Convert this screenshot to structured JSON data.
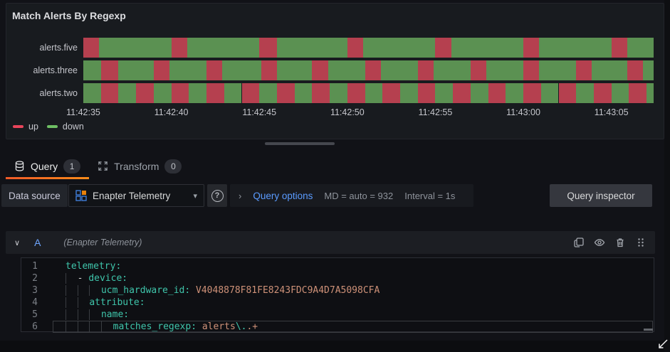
{
  "panel": {
    "title": "Match Alerts By Regexp"
  },
  "chart_data": {
    "type": "state-timeline",
    "title": "Match Alerts By Regexp",
    "time_start": "11:42:35",
    "time_span_seconds": 32.4,
    "ticks": [
      {
        "t": 0,
        "label": "11:42:35"
      },
      {
        "t": 5,
        "label": "11:42:40"
      },
      {
        "t": 10,
        "label": "11:42:45"
      },
      {
        "t": 15,
        "label": "11:42:50"
      },
      {
        "t": 20,
        "label": "11:42:55"
      },
      {
        "t": 25,
        "label": "11:43:00"
      },
      {
        "t": 30,
        "label": "11:43:05"
      }
    ],
    "legend_position": "bottom-left",
    "legend": [
      {
        "label": "up",
        "color": "#e8455a"
      },
      {
        "label": "down",
        "color": "#6ebf64"
      }
    ],
    "state_colors": {
      "up": "#b5404f",
      "down": "#5b9152"
    },
    "series": [
      {
        "name": "alerts.five",
        "segments": [
          [
            "up",
            0,
            0.9
          ],
          [
            "down",
            0.9,
            5
          ],
          [
            "up",
            5,
            5.9
          ],
          [
            "down",
            5.9,
            10
          ],
          [
            "up",
            10,
            11
          ],
          [
            "down",
            11,
            15
          ],
          [
            "up",
            15,
            15.9
          ],
          [
            "down",
            15.9,
            20
          ],
          [
            "up",
            20,
            20.9
          ],
          [
            "down",
            20.9,
            25
          ],
          [
            "up",
            25,
            25.9
          ],
          [
            "down",
            25.9,
            30
          ],
          [
            "up",
            30,
            30.9
          ],
          [
            "down",
            30.9,
            32.4
          ]
        ]
      },
      {
        "name": "alerts.three",
        "segments": [
          [
            "down",
            0,
            1
          ],
          [
            "up",
            1,
            2
          ],
          [
            "down",
            2,
            4
          ],
          [
            "up",
            4,
            4.9
          ],
          [
            "down",
            4.9,
            7
          ],
          [
            "up",
            7,
            7.9
          ],
          [
            "down",
            7.9,
            10.1
          ],
          [
            "up",
            10.1,
            11
          ],
          [
            "down",
            11,
            13
          ],
          [
            "up",
            13,
            13.9
          ],
          [
            "down",
            13.9,
            16
          ],
          [
            "up",
            16,
            16.9
          ],
          [
            "down",
            16.9,
            19
          ],
          [
            "up",
            19,
            19.9
          ],
          [
            "down",
            19.9,
            22
          ],
          [
            "up",
            22,
            22.9
          ],
          [
            "down",
            22.9,
            25
          ],
          [
            "up",
            25,
            25.9
          ],
          [
            "down",
            25.9,
            28
          ],
          [
            "up",
            28,
            28.9
          ],
          [
            "down",
            28.9,
            30.9
          ],
          [
            "up",
            30.9,
            31.8
          ],
          [
            "down",
            31.8,
            32.4
          ]
        ]
      },
      {
        "name": "alerts.two",
        "segments": [
          [
            "down",
            0,
            1
          ],
          [
            "up",
            1,
            2
          ],
          [
            "down",
            2,
            3
          ],
          [
            "up",
            3,
            4
          ],
          [
            "down",
            4,
            5
          ],
          [
            "up",
            5,
            6
          ],
          [
            "down",
            6,
            7
          ],
          [
            "up",
            7,
            8
          ],
          [
            "down",
            8,
            9
          ],
          [
            "up",
            9,
            10
          ],
          [
            "down",
            10,
            11
          ],
          [
            "up",
            11,
            12
          ],
          [
            "down",
            12,
            13
          ],
          [
            "up",
            13,
            14
          ],
          [
            "down",
            14,
            15
          ],
          [
            "up",
            15,
            16
          ],
          [
            "down",
            16,
            17
          ],
          [
            "up",
            17,
            18
          ],
          [
            "down",
            18,
            19
          ],
          [
            "up",
            19,
            20
          ],
          [
            "down",
            20,
            21
          ],
          [
            "up",
            21,
            22
          ],
          [
            "down",
            22,
            23
          ],
          [
            "up",
            23,
            24
          ],
          [
            "down",
            24,
            25
          ],
          [
            "up",
            25,
            26
          ],
          [
            "down",
            26,
            27
          ],
          [
            "up",
            27,
            28
          ],
          [
            "down",
            28,
            29
          ],
          [
            "up",
            29,
            30
          ],
          [
            "down",
            30,
            31
          ],
          [
            "up",
            31,
            32
          ],
          [
            "down",
            32,
            32.4
          ]
        ]
      }
    ]
  },
  "tabs": {
    "query": {
      "label": "Query",
      "count": "1"
    },
    "transform": {
      "label": "Transform",
      "count": "0"
    }
  },
  "toolbar": {
    "datasource_label": "Data source",
    "datasource_value": "Enapter Telemetry",
    "help_glyph": "?",
    "options_chevron": "›",
    "query_options_label": "Query options",
    "max_data_points": "MD = auto = 932",
    "interval": "Interval = 1s",
    "query_inspector_label": "Query inspector"
  },
  "query_row": {
    "collapse_chevron": "∨",
    "ref_id": "A",
    "datasource_hint": "(Enapter Telemetry)"
  },
  "code": {
    "lines": [
      {
        "num": "1",
        "tokens": [
          [
            "key",
            "telemetry:"
          ]
        ]
      },
      {
        "num": "2",
        "tokens": [
          [
            "guide",
            "  "
          ],
          [
            "plain",
            "- "
          ],
          [
            "key",
            "device:"
          ]
        ]
      },
      {
        "num": "3",
        "tokens": [
          [
            "guide",
            "  "
          ],
          [
            "guide",
            "  "
          ],
          [
            "guide",
            "  "
          ],
          [
            "key",
            "ucm_hardware_id:"
          ],
          [
            "plain",
            " "
          ],
          [
            "value",
            "V4048878F81FE8243FDC9A4D7A5098CFA"
          ]
        ]
      },
      {
        "num": "4",
        "tokens": [
          [
            "guide",
            "  "
          ],
          [
            "guide",
            "  "
          ],
          [
            "key",
            "attribute:"
          ]
        ]
      },
      {
        "num": "5",
        "tokens": [
          [
            "guide",
            "  "
          ],
          [
            "guide",
            "  "
          ],
          [
            "guide",
            "  "
          ],
          [
            "key",
            "name:"
          ]
        ]
      },
      {
        "num": "6",
        "tokens": [
          [
            "guide",
            "  "
          ],
          [
            "guide",
            "  "
          ],
          [
            "guide",
            "  "
          ],
          [
            "guide",
            "  "
          ],
          [
            "key",
            "matches_regexp:"
          ],
          [
            "plain",
            " "
          ],
          [
            "value",
            "alerts"
          ],
          [
            "key",
            "\\."
          ],
          [
            "value",
            ".+"
          ]
        ]
      }
    ]
  },
  "colors": {
    "accent_orange": "#f05a28",
    "link_blue": "#5a9bff",
    "panel_bg": "#181b1f",
    "page_bg": "#111217"
  }
}
